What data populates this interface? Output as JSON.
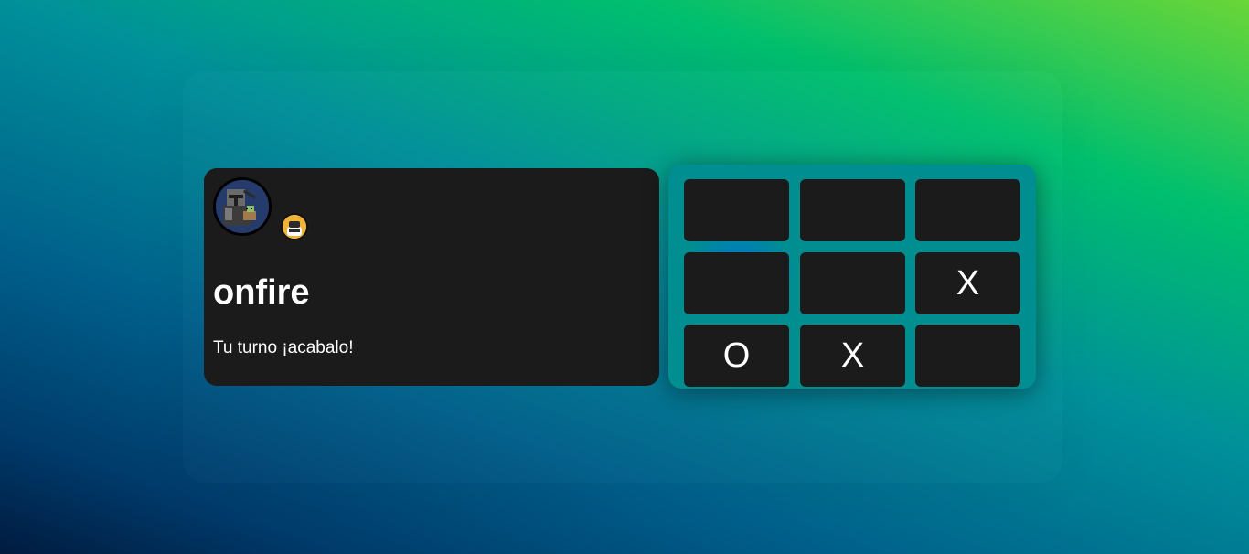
{
  "player": {
    "name": "onfire",
    "status": "Tu turno ¡acabalo!"
  },
  "board": {
    "cells": [
      "",
      "",
      "",
      "",
      "",
      "X",
      "O",
      "X",
      ""
    ]
  },
  "colors": {
    "card_bg": "#1b1b1b",
    "board_bg": "#008e90",
    "text": "#ffffff"
  },
  "icons": {
    "avatar": "player-avatar-icon",
    "opponent": "opponent-avatar-icon"
  }
}
